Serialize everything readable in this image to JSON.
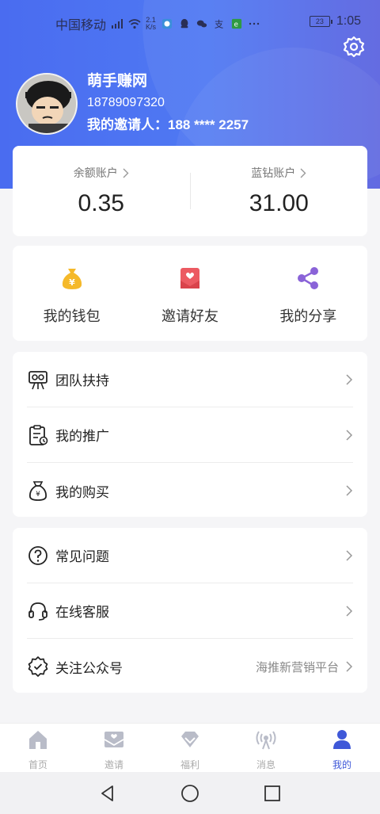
{
  "status_bar": {
    "carrier": "中国移动",
    "net_speed_value": "2.1",
    "net_speed_unit": "K/s",
    "battery": "23",
    "time": "1:05"
  },
  "profile": {
    "name": "萌手赚网",
    "phone": "18789097320",
    "inviter": "我的邀请人：188 **** 2257"
  },
  "balances": [
    {
      "label": "余额账户",
      "value": "0.35"
    },
    {
      "label": "蓝钻账户",
      "value": "31.00"
    }
  ],
  "quick_actions": [
    {
      "label": "我的钱包",
      "icon": "money-bag-icon",
      "color": "#f5b92a"
    },
    {
      "label": "邀请好友",
      "icon": "invite-envelope-icon",
      "color": "#ec5a62"
    },
    {
      "label": "我的分享",
      "icon": "share-icon",
      "color": "#8a63d8"
    }
  ],
  "menu_group1": [
    {
      "label": "团队扶持",
      "icon": "team-support-icon"
    },
    {
      "label": "我的推广",
      "icon": "promotion-clipboard-icon"
    },
    {
      "label": "我的购买",
      "icon": "purchase-bag-icon"
    }
  ],
  "menu_group2": [
    {
      "label": "常见问题",
      "icon": "question-icon",
      "extra": ""
    },
    {
      "label": "在线客服",
      "icon": "headset-icon",
      "extra": ""
    },
    {
      "label": "关注公众号",
      "icon": "verified-badge-icon",
      "extra": "海推新营销平台"
    }
  ],
  "tabs": [
    {
      "label": "首页",
      "icon": "home-icon",
      "active": false
    },
    {
      "label": "邀请",
      "icon": "invite-tab-icon",
      "active": false
    },
    {
      "label": "福利",
      "icon": "diamond-icon",
      "active": false
    },
    {
      "label": "消息",
      "icon": "broadcast-icon",
      "active": false
    },
    {
      "label": "我的",
      "icon": "user-icon",
      "active": true
    }
  ],
  "colors": {
    "header_start": "#4a6cf0",
    "header_end": "#5b63e0",
    "tab_active": "#3f58d8",
    "tab_inactive": "#aaaaaa"
  }
}
